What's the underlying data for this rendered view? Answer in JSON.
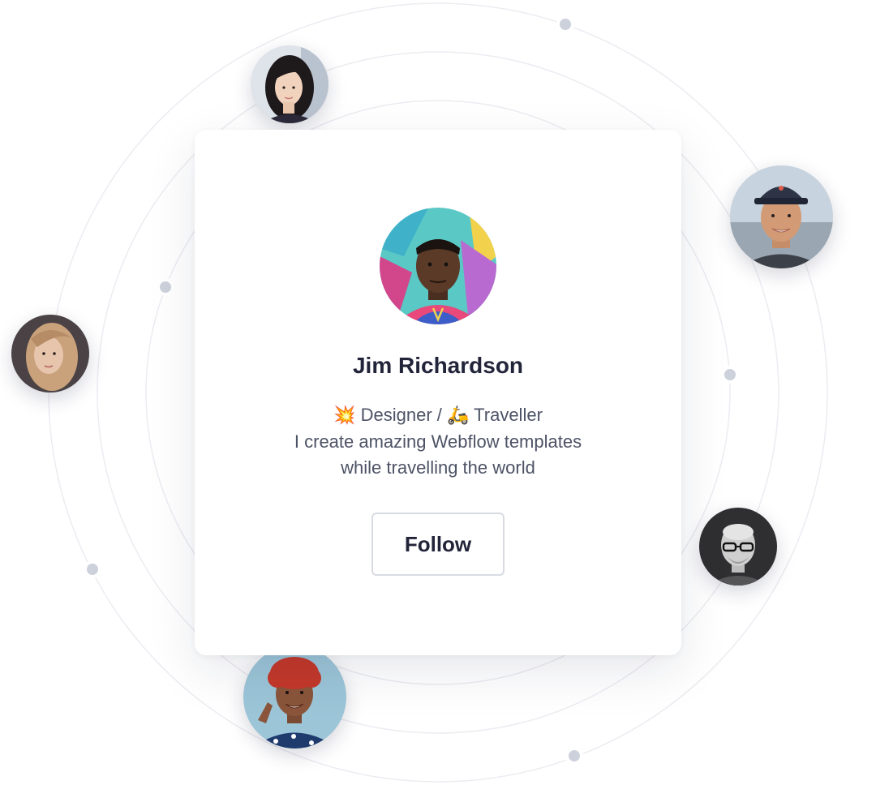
{
  "profile": {
    "name": "Jim Richardson",
    "bio_line1_emoji1": "💥",
    "bio_line1_text1": "Designer /",
    "bio_line1_emoji2": "🛵",
    "bio_line1_text2": "Traveller",
    "bio_line2": "I create amazing Webflow templates",
    "bio_line3": "while travelling the world",
    "follow_label": "Follow"
  },
  "colors": {
    "title": "#22243a",
    "body_text": "#4d5366",
    "orbit": "#ececf2",
    "orbit_dot": "#cdd1dc"
  },
  "avatars": [
    {
      "name": "woman-dark-hair-avatar"
    },
    {
      "name": "man-cap-avatar"
    },
    {
      "name": "woman-blonde-avatar"
    },
    {
      "name": "older-man-glasses-avatar"
    },
    {
      "name": "woman-red-hair-avatar"
    }
  ]
}
